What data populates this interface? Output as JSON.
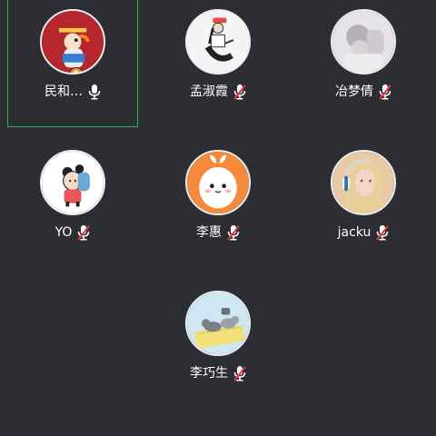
{
  "participants": [
    {
      "name": "民和…",
      "avatar": "cartoon-figure-red-avatar",
      "muted": false,
      "speaking": true,
      "host": true
    },
    {
      "name": "孟淑霞",
      "avatar": "sketch-girl-avatar",
      "muted": true,
      "speaking": false,
      "host": false
    },
    {
      "name": "冶梦倩",
      "avatar": "photo-pale-avatar",
      "muted": true,
      "speaking": false,
      "host": false
    },
    {
      "name": "YO",
      "avatar": "cartoon-girl-headphones-avatar",
      "muted": true,
      "speaking": false,
      "host": false
    },
    {
      "name": "李惠",
      "avatar": "bunny-ghost-avatar",
      "muted": true,
      "speaking": false,
      "host": false
    },
    {
      "name": "jacku",
      "avatar": "blonde-headphones-avatar",
      "muted": true,
      "speaking": false,
      "host": false
    },
    {
      "name": "李巧生",
      "avatar": "cats-on-mat-avatar",
      "muted": true,
      "speaking": false,
      "host": false
    }
  ],
  "colors": {
    "background": "#2c2e33",
    "speaking_border": "#1fb550",
    "muted_red": "#e0383e",
    "host_badge": "#f29a2e"
  }
}
